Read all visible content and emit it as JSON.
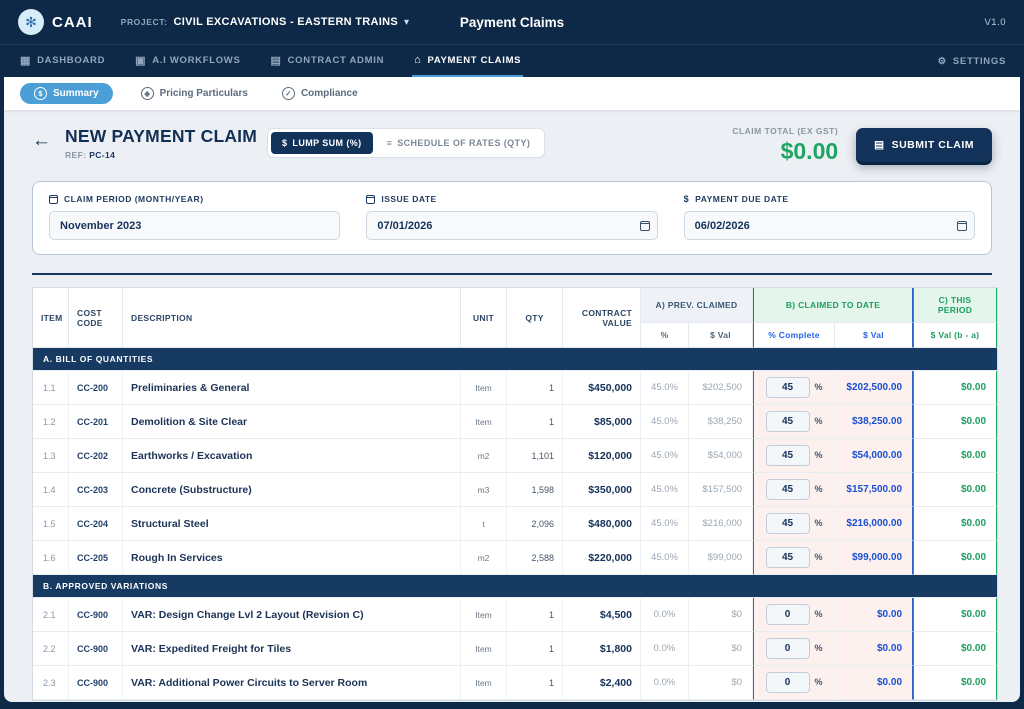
{
  "colors": {
    "navy": "#0e2947",
    "accent_blue": "#4b9fd6",
    "green": "#1ea563",
    "value_blue": "#1a4fd1",
    "pink_bg": "#fdf1f0",
    "green_bg": "#e4f5ec"
  },
  "icons": {
    "logo": "✻",
    "chevron_down": "▾",
    "dashboard": "▦",
    "workflows": "▣",
    "contract": "▤",
    "claims": "⌂",
    "settings": "⚙",
    "summary": "$",
    "pricing": "◈",
    "compliance": "✓",
    "back_arrow": "←",
    "lump_sum": "$",
    "schedule": "≡",
    "submit": "▤",
    "dollar": "$"
  },
  "topbar": {
    "logo_text": "CAAI",
    "project_label": "PROJECT:",
    "project_name": "CIVIL EXCAVATIONS - EASTERN TRAINS",
    "page_title": "Payment Claims",
    "version": "V1.0"
  },
  "nav": {
    "items": [
      {
        "label": "DASHBOARD"
      },
      {
        "label": "A.I WORKFLOWS"
      },
      {
        "label": "CONTRACT ADMIN"
      },
      {
        "label": "PAYMENT CLAIMS"
      }
    ],
    "settings_label": "SETTINGS"
  },
  "subnav": {
    "tabs": [
      {
        "label": "Summary"
      },
      {
        "label": "Pricing Particulars"
      },
      {
        "label": "Compliance"
      }
    ]
  },
  "header": {
    "title": "NEW PAYMENT CLAIM",
    "ref_label": "REF:",
    "ref_value": "PC-14",
    "lump_sum_label": "LUMP SUM (%)",
    "schedule_label": "SCHEDULE OF RATES (QTY)",
    "claim_total_label": "CLAIM TOTAL (EX GST)",
    "claim_total_value": "$0.00",
    "submit_label": "SUBMIT CLAIM"
  },
  "dates": {
    "claim_period": {
      "label": "CLAIM PERIOD (MONTH/YEAR)",
      "value": "November 2023"
    },
    "issue_date": {
      "label": "ISSUE DATE",
      "value": "07/01/2026"
    },
    "due_date": {
      "label": "PAYMENT DUE DATE",
      "value": "06/02/2026"
    }
  },
  "table": {
    "pct_suffix": "%",
    "headers": {
      "item": "ITEM",
      "cost_code": "COST CODE",
      "description": "DESCRIPTION",
      "unit": "UNIT",
      "qty": "QTY",
      "contract_value": "CONTRACT VALUE",
      "prev_claimed": "A) PREV. CLAIMED",
      "prev_pct": "%",
      "prev_val": "$ Val",
      "claimed_to_date": "B) CLAIMED TO DATE",
      "ctd_pct": "% Complete",
      "ctd_val": "$ Val",
      "this_period": "C) THIS PERIOD",
      "tp_val": "$ Val (b - a)"
    },
    "sections": [
      {
        "title": "A. BILL OF QUANTITIES",
        "rows": [
          {
            "item": "1.1",
            "code": "CC-200",
            "desc": "Preliminaries & General",
            "unit": "Item",
            "qty": "1",
            "contract": "$450,000",
            "prev_pct": "45.0%",
            "prev_val": "$202,500",
            "ctd_pct": "45",
            "ctd_val": "$202,500.00",
            "tp_val": "$0.00"
          },
          {
            "item": "1.2",
            "code": "CC-201",
            "desc": "Demolition & Site Clear",
            "unit": "Item",
            "qty": "1",
            "contract": "$85,000",
            "prev_pct": "45.0%",
            "prev_val": "$38,250",
            "ctd_pct": "45",
            "ctd_val": "$38,250.00",
            "tp_val": "$0.00"
          },
          {
            "item": "1.3",
            "code": "CC-202",
            "desc": "Earthworks / Excavation",
            "unit": "m2",
            "qty": "1,101",
            "contract": "$120,000",
            "prev_pct": "45.0%",
            "prev_val": "$54,000",
            "ctd_pct": "45",
            "ctd_val": "$54,000.00",
            "tp_val": "$0.00"
          },
          {
            "item": "1.4",
            "code": "CC-203",
            "desc": "Concrete (Substructure)",
            "unit": "m3",
            "qty": "1,598",
            "contract": "$350,000",
            "prev_pct": "45.0%",
            "prev_val": "$157,500",
            "ctd_pct": "45",
            "ctd_val": "$157,500.00",
            "tp_val": "$0.00"
          },
          {
            "item": "1.5",
            "code": "CC-204",
            "desc": "Structural Steel",
            "unit": "t",
            "qty": "2,096",
            "contract": "$480,000",
            "prev_pct": "45.0%",
            "prev_val": "$216,000",
            "ctd_pct": "45",
            "ctd_val": "$216,000.00",
            "tp_val": "$0.00"
          },
          {
            "item": "1.6",
            "code": "CC-205",
            "desc": "Rough In Services",
            "unit": "m2",
            "qty": "2,588",
            "contract": "$220,000",
            "prev_pct": "45.0%",
            "prev_val": "$99,000",
            "ctd_pct": "45",
            "ctd_val": "$99,000.00",
            "tp_val": "$0.00"
          }
        ]
      },
      {
        "title": "B. APPROVED VARIATIONS",
        "rows": [
          {
            "item": "2.1",
            "code": "CC-900",
            "desc": "VAR: Design Change Lvl 2 Layout (Revision C)",
            "unit": "Item",
            "qty": "1",
            "contract": "$4,500",
            "prev_pct": "0.0%",
            "prev_val": "$0",
            "ctd_pct": "0",
            "ctd_val": "$0.00",
            "tp_val": "$0.00"
          },
          {
            "item": "2.2",
            "code": "CC-900",
            "desc": "VAR: Expedited Freight for Tiles",
            "unit": "Item",
            "qty": "1",
            "contract": "$1,800",
            "prev_pct": "0.0%",
            "prev_val": "$0",
            "ctd_pct": "0",
            "ctd_val": "$0.00",
            "tp_val": "$0.00"
          },
          {
            "item": "2.3",
            "code": "CC-900",
            "desc": "VAR: Additional Power Circuits to Server Room",
            "unit": "Item",
            "qty": "1",
            "contract": "$2,400",
            "prev_pct": "0.0%",
            "prev_val": "$0",
            "ctd_pct": "0",
            "ctd_val": "$0.00",
            "tp_val": "$0.00"
          }
        ]
      }
    ]
  }
}
